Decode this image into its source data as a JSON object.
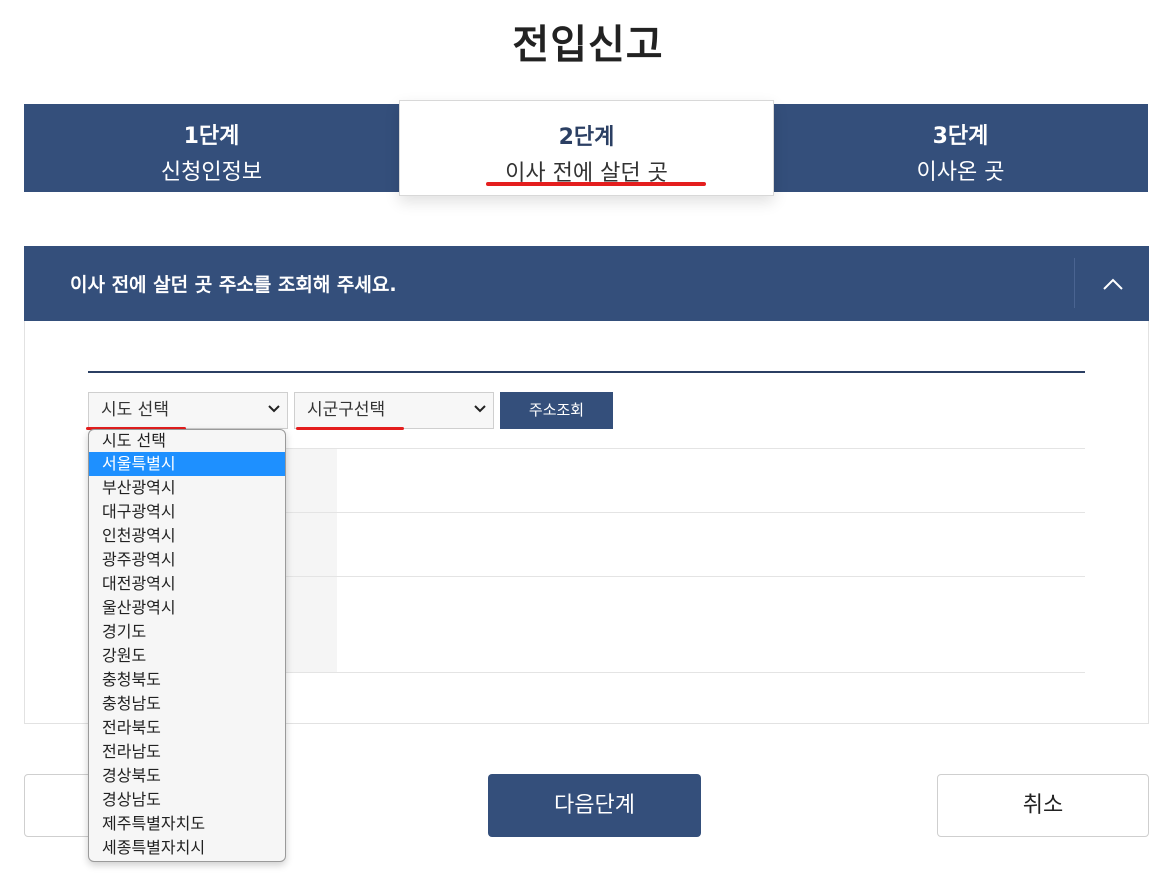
{
  "page": {
    "title": "전입신고"
  },
  "steps": [
    {
      "num": "1단계",
      "name": "신청인정보"
    },
    {
      "num": "2단계",
      "name": "이사 전에 살던 곳"
    },
    {
      "num": "3단계",
      "name": "이사온 곳"
    }
  ],
  "section": {
    "header": "이사 전에 살던 곳 주소를 조회해 주세요.",
    "toggle_icon": "chevron-up-icon"
  },
  "address": {
    "sido_value": "시도 선택",
    "sigungu_value": "시군구선택",
    "search_label": "주소조회"
  },
  "dropdown": {
    "selected_index": 1,
    "options": [
      "시도 선택",
      "서울특별시",
      "부산광역시",
      "대구광역시",
      "인천광역시",
      "광주광역시",
      "대전광역시",
      "울산광역시",
      "경기도",
      "강원도",
      "충청북도",
      "충청남도",
      "전라북도",
      "전라남도",
      "경상북도",
      "경상남도",
      "제주특별자치도",
      "세종특별자치시"
    ]
  },
  "buttons": {
    "next": "다음단계",
    "cancel": "취소"
  },
  "colors": {
    "primary": "#344f7b",
    "highlight": "#e41e1e",
    "selected": "#1e90ff"
  }
}
